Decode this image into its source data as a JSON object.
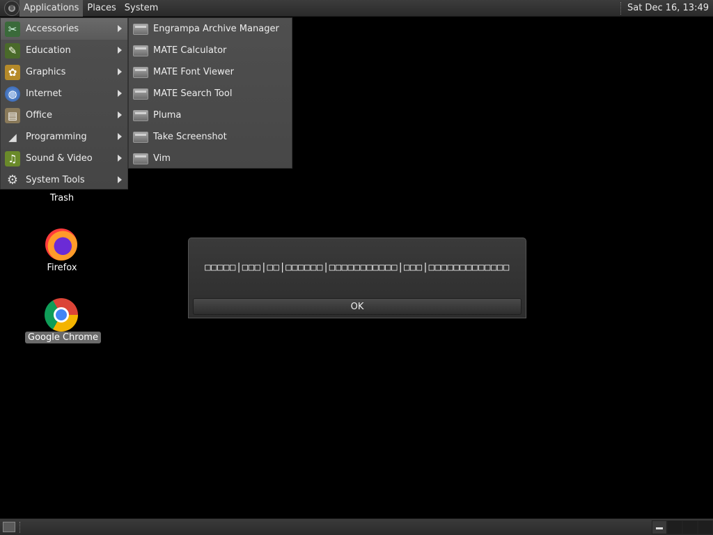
{
  "top_panel": {
    "menus": [
      "Applications",
      "Places",
      "System"
    ],
    "clock": "Sat Dec 16, 13:49"
  },
  "app_menu": {
    "items": [
      {
        "label": "Accessories",
        "icon": "accessories-icon"
      },
      {
        "label": "Education",
        "icon": "education-icon"
      },
      {
        "label": "Graphics",
        "icon": "graphics-icon"
      },
      {
        "label": "Internet",
        "icon": "internet-icon"
      },
      {
        "label": "Office",
        "icon": "office-icon"
      },
      {
        "label": "Programming",
        "icon": "programming-icon"
      },
      {
        "label": "Sound & Video",
        "icon": "sound-video-icon"
      },
      {
        "label": "System Tools",
        "icon": "system-tools-icon"
      }
    ]
  },
  "accessories_menu": {
    "items": [
      "Engrampa Archive Manager",
      "MATE Calculator",
      "MATE Font Viewer",
      "MATE Search Tool",
      "Pluma",
      "Take Screenshot",
      "Vim"
    ]
  },
  "desktop": {
    "trash_label": "Trash",
    "firefox_label": "Firefox",
    "chrome_label": "Google Chrome"
  },
  "dialog": {
    "message": "□□□□□|□□□|□□|□□□□□□|□□□□□□□□□□□|□□□|□□□□□□□□□□□□□",
    "ok_label": "OK"
  }
}
